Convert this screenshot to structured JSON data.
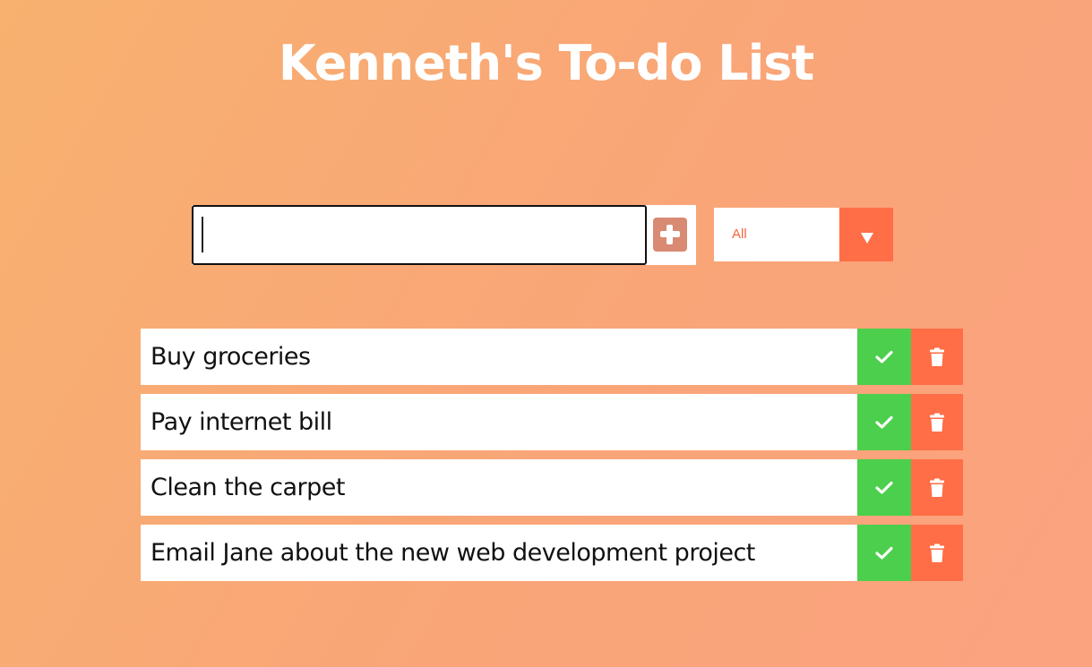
{
  "header": {
    "title": "Kenneth's To-do List"
  },
  "form": {
    "input_value": "",
    "add_icon": "plus-square-icon",
    "filter": {
      "selected": "All",
      "icon": "chevron-down-icon"
    }
  },
  "todos": [
    {
      "text": "Buy groceries",
      "completed": false
    },
    {
      "text": "Pay internet bill",
      "completed": false
    },
    {
      "text": "Clean the carpet",
      "completed": false
    },
    {
      "text": "Email Jane about the new web development project",
      "completed": false
    }
  ],
  "colors": {
    "complete": "#4ccf4c",
    "delete": "#ff6e46",
    "add_icon": "#d98a73",
    "filter_text": "#f5653f"
  }
}
